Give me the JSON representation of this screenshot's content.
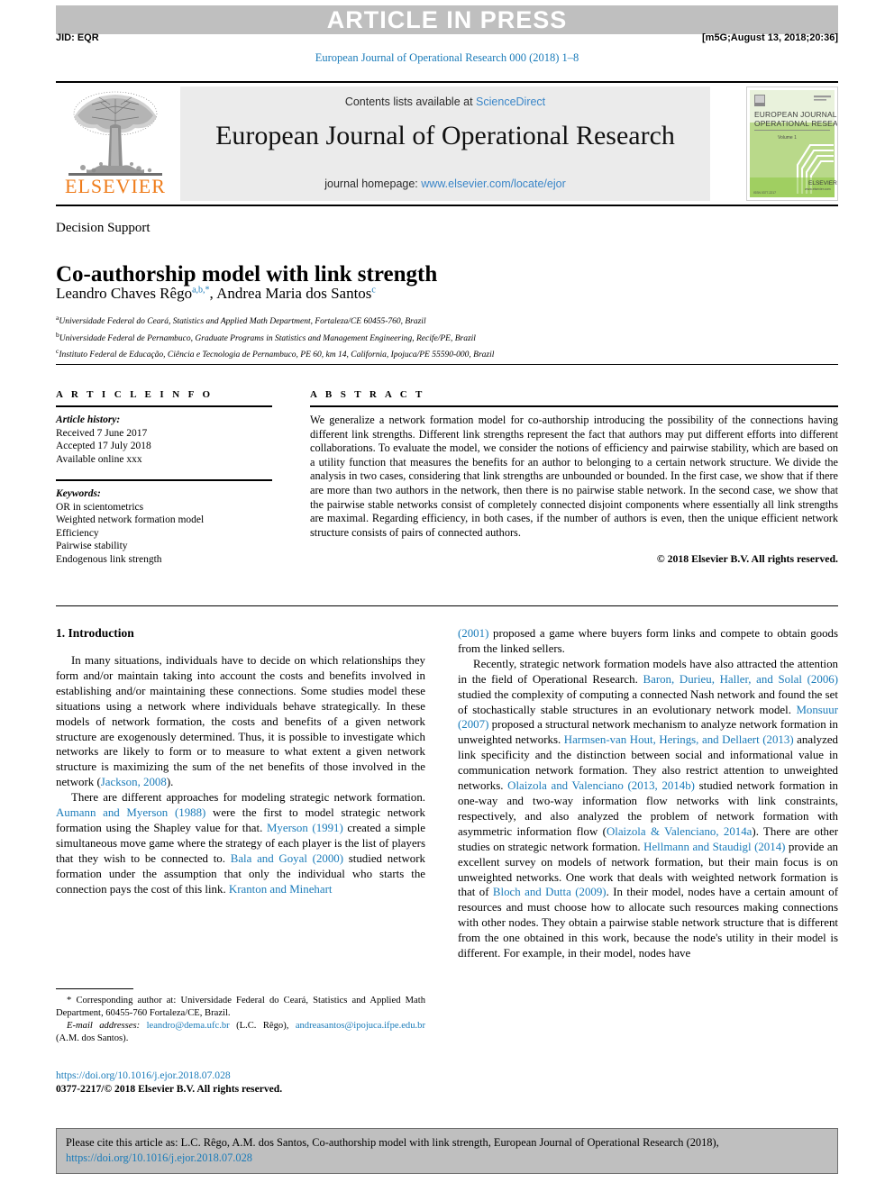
{
  "header": {
    "press_banner": "ARTICLE IN PRESS",
    "jid": "JID: EQR",
    "stamp": "[m5G;August 13, 2018;20:36]",
    "running_head": "European Journal of Operational Research 000 (2018) 1–8"
  },
  "masthead": {
    "contents_prefix": "Contents lists available at",
    "sciencedirect": "ScienceDirect",
    "journal_title": "European Journal of Operational Research",
    "homepage_prefix": "journal homepage:",
    "homepage_url": "www.elsevier.com/locate/ejor",
    "publisher_wordmark": "ELSEVIER",
    "cover_line1": "EUROPEAN JOURNAL OF",
    "cover_line2": "OPERATIONAL RESEARCH"
  },
  "article": {
    "section_label": "Decision Support",
    "title": "Co-authorship model with link strength",
    "author_1": "Leandro Chaves Rêgo",
    "author_1_marks": "a,b,*",
    "author_separator": ", ",
    "author_2": "Andrea Maria dos Santos",
    "author_2_marks": "c",
    "affiliations": [
      {
        "mark": "a",
        "text": "Universidade Federal do Ceará, Statistics and Applied Math Department, Fortaleza/CE 60455-760, Brazil"
      },
      {
        "mark": "b",
        "text": "Universidade Federal de Pernambuco, Graduate Programs in Statistics and Management Engineering, Recife/PE, Brazil"
      },
      {
        "mark": "c",
        "text": "Instituto Federal de Educação, Ciência e Tecnologia de Pernambuco, PE 60, km 14, California, Ipojuca/PE 55590-000, Brazil"
      }
    ]
  },
  "article_info": {
    "heading": "A R T I C L E    I N F O",
    "history_label": "Article history:",
    "received": "Received 7 June 2017",
    "accepted": "Accepted 17 July 2018",
    "available": "Available online xxx",
    "keywords_label": "Keywords:",
    "keywords": [
      "OR in scientometrics",
      "Weighted network formation model",
      "Efficiency",
      "Pairwise stability",
      "Endogenous link strength"
    ]
  },
  "abstract": {
    "heading": "A B S T R A C T",
    "body": "We generalize a network formation model for co-authorship introducing the possibility of the connections having different link strengths. Different link strengths represent the fact that authors may put different efforts into different collaborations. To evaluate the model, we consider the notions of efficiency and pairwise stability, which are based on a utility function that measures the benefits for an author to belonging to a certain network structure. We divide the analysis in two cases, considering that link strengths are unbounded or bounded. In the first case, we show that if there are more than two authors in the network, then there is no pairwise stable network. In the second case, we show that the pairwise stable networks consist of completely connected disjoint components where essentially all link strengths are maximal. Regarding efficiency, in both cases, if the number of authors is even, then the unique efficient network structure consists of pairs of connected authors.",
    "copyright": "© 2018 Elsevier B.V. All rights reserved."
  },
  "body": {
    "section_heading": "1. Introduction",
    "left_paragraphs": [
      {
        "segments": [
          {
            "t": "In many situations, individuals have to decide on which relationships they form and/or maintain taking into account the costs and benefits involved in establishing and/or maintaining these connections. Some studies model these situations using a network where individuals behave strategically. In these models of network formation, the costs and benefits of a given network structure are exogenously determined. Thus, it is possible to investigate which networks are likely to form or to measure to what extent a given network structure is maximizing the sum of the net benefits of those involved in the network (",
            "link": false
          },
          {
            "t": "Jackson, 2008",
            "link": true
          },
          {
            "t": ").",
            "link": false
          }
        ]
      },
      {
        "segments": [
          {
            "t": "There are different approaches for modeling strategic network formation. ",
            "link": false
          },
          {
            "t": "Aumann and Myerson (1988)",
            "link": true
          },
          {
            "t": " were the first to model strategic network formation using the Shapley value for that. ",
            "link": false
          },
          {
            "t": "Myerson (1991)",
            "link": true
          },
          {
            "t": " created a simple simultaneous move game where the strategy of each player is the list of players that they wish to be connected to. ",
            "link": false
          },
          {
            "t": "Bala and Goyal (2000)",
            "link": true
          },
          {
            "t": " studied network formation under the assumption that only the individual who starts the connection pays the cost of this link. ",
            "link": false
          },
          {
            "t": "Kranton and Minehart",
            "link": true
          }
        ]
      }
    ],
    "right_paragraphs": [
      {
        "segments": [
          {
            "t": "(2001)",
            "link": true
          },
          {
            "t": " proposed a game where buyers form links and compete to obtain goods from the linked sellers.",
            "link": false
          }
        ]
      },
      {
        "segments": [
          {
            "t": "Recently, strategic network formation models have also attracted the attention in the field of Operational Research. ",
            "link": false
          },
          {
            "t": "Baron, Durieu, Haller, and Solal (2006)",
            "link": true
          },
          {
            "t": " studied the complexity of computing a connected Nash network and found the set of stochastically stable structures in an evolutionary network model. ",
            "link": false
          },
          {
            "t": "Monsuur (2007)",
            "link": true
          },
          {
            "t": " proposed a structural network mechanism to analyze network formation in unweighted networks. ",
            "link": false
          },
          {
            "t": "Harmsen-van Hout, Herings, and Dellaert (2013)",
            "link": true
          },
          {
            "t": " analyzed link specificity and the distinction between social and informational value in communication network formation. They also restrict attention to unweighted networks. ",
            "link": false
          },
          {
            "t": "Olaizola and Valenciano (2013, 2014b)",
            "link": true
          },
          {
            "t": " studied network formation in one-way and two-way information flow networks with link constraints, respectively, and also analyzed the problem of network formation with asymmetric information flow (",
            "link": false
          },
          {
            "t": "Olaizola & Valenciano, 2014a",
            "link": true
          },
          {
            "t": "). There are other studies on strategic network formation. ",
            "link": false
          },
          {
            "t": "Hellmann and Staudigl (2014)",
            "link": true
          },
          {
            "t": " provide an excellent survey on models of network formation, but their main focus is on unweighted networks. One work that deals with weighted network formation is that of ",
            "link": false
          },
          {
            "t": "Bloch and Dutta (2009)",
            "link": true
          },
          {
            "t": ". In their model, nodes have a certain amount of resources and must choose how to allocate such resources making connections with other nodes. They obtain a pairwise stable network structure that is different from the one obtained in this work, because the node's utility in their model is different. For example, in their model, nodes have",
            "link": false
          }
        ]
      }
    ]
  },
  "footnote": {
    "star": "*",
    "corresponding": "Corresponding author at: Universidade Federal do Ceará, Statistics and Applied Math Department, 60455-760 Fortaleza/CE, Brazil.",
    "email_label": "E-mail addresses:",
    "email_1": "leandro@dema.ufc.br",
    "email_1_owner": "(L.C. Rêgo),",
    "email_2": "andreasantos@ipojuca.ifpe.edu.br",
    "email_2_owner": "(A.M. dos Santos)."
  },
  "doi_block": {
    "doi": "https://doi.org/10.1016/j.ejor.2018.07.028",
    "issn_line": "0377-2217/© 2018 Elsevier B.V. All rights reserved."
  },
  "citation_box": {
    "prefix": "Please cite this article as: L.C. Rêgo, A.M. dos Santos, Co-authorship model with link strength, European Journal of Operational Research (2018), ",
    "link": "https://doi.org/10.1016/j.ejor.2018.07.028"
  },
  "colors": {
    "link": "#1a7bb9",
    "sciencedirect": "#3a86c8",
    "elsevier_orange": "#ef7c1a",
    "banner_gray": "#bfbfbf",
    "masthead_gray": "#ebebeb",
    "cover_green": "#8cc63f"
  }
}
